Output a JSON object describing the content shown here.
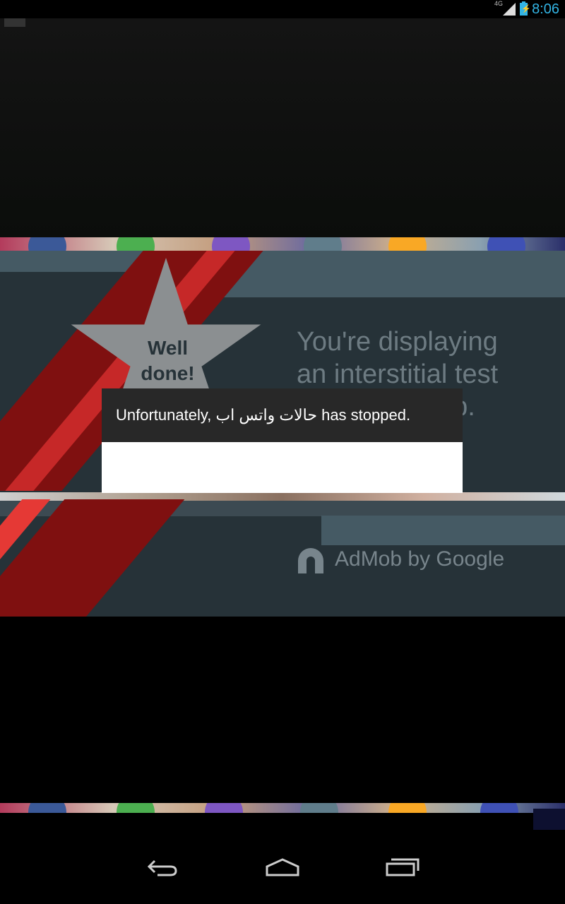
{
  "status_bar": {
    "network": "4G",
    "battery_symbol": "⚡",
    "time": "8:06"
  },
  "ad": {
    "badge_line1": "Well",
    "badge_line2": "done!",
    "line1": "You're displaying",
    "line2": "an interstitial test",
    "line3": "ob.",
    "footer": "AdMob by Google"
  },
  "dialog": {
    "message": "Unfortunately, حالات واتس اب has stopped.",
    "button_label": ""
  },
  "navbar": {
    "back_icon": "back-icon",
    "home_icon": "home-icon",
    "recents_icon": "recents-icon"
  },
  "colors": {
    "accent": "#33b5e5",
    "ad_bg": "#263238",
    "ad_band": "#455a64",
    "red": "#b71c1c"
  }
}
